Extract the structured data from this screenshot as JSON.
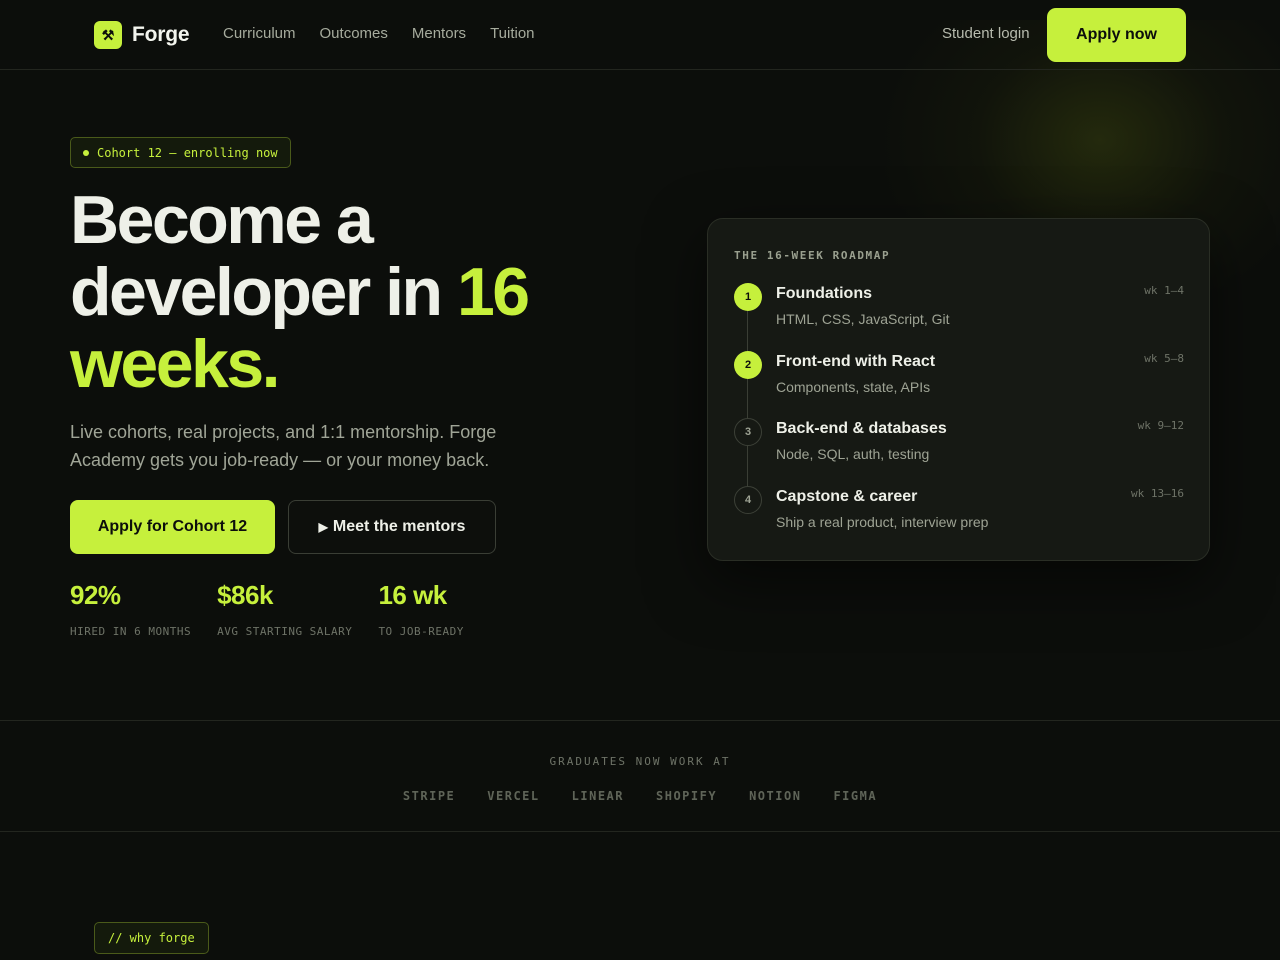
{
  "nav": {
    "brand_icon": "hammer-pick-icon",
    "brand_name": "Forge",
    "links": [
      "Curriculum",
      "Outcomes",
      "Mentors",
      "Tuition"
    ],
    "login": "Student login",
    "apply": "Apply now"
  },
  "hero": {
    "badge": "Cohort 12 — enrolling now",
    "headline_line1": "Become a",
    "headline_line2": "developer in ",
    "headline_highlight_1": "16",
    "headline_highlight_2": "weeks.",
    "subtitle": "Live cohorts, real projects, and 1:1 mentorship. Forge Academy gets you job-ready — or your money back.",
    "cta_primary": "Apply for Cohort 12",
    "cta_secondary": "Meet the mentors",
    "cta_secondary_icon": "play-icon"
  },
  "stats": [
    {
      "value": "92%",
      "label": "HIRED IN 6 MONTHS"
    },
    {
      "value": "$86k",
      "label": "AVG STARTING SALARY"
    },
    {
      "value": "16 wk",
      "label": "TO JOB-READY"
    }
  ],
  "roadmap": {
    "title": "THE 16-WEEK ROADMAP",
    "steps": [
      {
        "num": "1",
        "title": "Foundations",
        "desc": "HTML, CSS, JavaScript, Git",
        "weeks": "wk 1–4",
        "state": "done"
      },
      {
        "num": "2",
        "title": "Front-end with React",
        "desc": "Components, state, APIs",
        "weeks": "wk 5–8",
        "state": "done"
      },
      {
        "num": "3",
        "title": "Back-end & databases",
        "desc": "Node, SQL, auth, testing",
        "weeks": "wk 9–12",
        "state": "todo"
      },
      {
        "num": "4",
        "title": "Capstone & career",
        "desc": "Ship a real product, interview prep",
        "weeks": "wk 13–16",
        "state": "todo"
      }
    ]
  },
  "logos": {
    "title": "GRADUATES NOW WORK AT",
    "items": [
      "STRIPE",
      "VERCEL",
      "LINEAR",
      "SHOPIFY",
      "NOTION",
      "FIGMA"
    ]
  },
  "why": {
    "badge": "// why forge"
  },
  "colors": {
    "accent": "#c6f03c",
    "background": "#0c0e0b",
    "card": "#161914"
  }
}
